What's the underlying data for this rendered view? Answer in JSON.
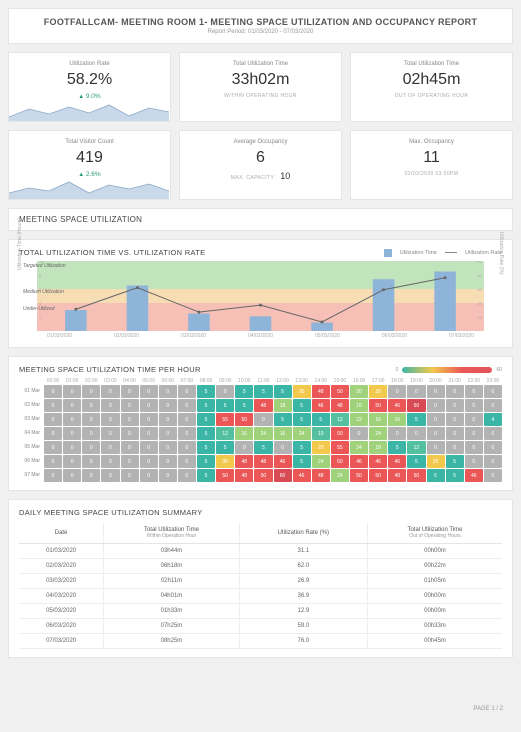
{
  "header": {
    "title": "FOOTFALLCAM- MEETING ROOM 1- MEETING SPACE UTILIZATION AND OCCUPANCY REPORT",
    "subtitle": "Report Period: 01/03/2020 - 07/03/2020"
  },
  "kpi": {
    "util_rate": {
      "label": "Utilization Rate",
      "value": "58.2%",
      "delta": "9.0%"
    },
    "util_time_in": {
      "label": "Total Utilization Time",
      "value": "33h02m",
      "caption": "WITHIN OPERATING HOUR"
    },
    "util_time_out": {
      "label": "Total Utilization Time",
      "value": "02h45m",
      "caption": "OUT OF OPERATING HOUR"
    },
    "visitor": {
      "label": "Total Visitor Count",
      "value": "419",
      "delta": "2.6%"
    },
    "avg_occ": {
      "label": "Average Occupancy",
      "value": "6",
      "maxcap_label": "MAX. CAPACITY",
      "maxcap_value": "10"
    },
    "max_occ": {
      "label": "Max. Occupancy",
      "value": "11",
      "caption": "02/03/2020 03:00PM"
    }
  },
  "sections": {
    "meeting_space": "MEETING SPACE UTILIZATION",
    "chart1_title": "TOTAL UTILIZATION TIME VS. UTILIZATION RATE",
    "legend_bar": "Utilization Time",
    "legend_line": "Utilization Rate",
    "y_left": "Utilization Time (Hours)",
    "y_right": "Utilization Rate (%)",
    "band_target": "Targeted Utilization",
    "band_medium": "Medium Utilization",
    "band_under": "Under-Utilized",
    "heatmap_title": "MEETING SPACE UTILIZATION TIME PER HOUR",
    "summary_title": "DAILY MEETING SPACE UTILIZATION SUMMARY",
    "colorbar_min": "0",
    "colorbar_max": "60"
  },
  "chart_data": [
    {
      "type": "bar+line",
      "title": "TOTAL UTILIZATION TIME VS. UTILIZATION RATE",
      "categories": [
        "01/03/2020",
        "02/03/2020",
        "03/03/2020",
        "04/03/2020",
        "05/03/2020",
        "06/03/2020",
        "07/03/2020"
      ],
      "series": [
        {
          "name": "Utilization Time",
          "type": "bar",
          "axis": "left",
          "values": [
            3.0,
            6.5,
            2.5,
            2.1,
            1.2,
            7.4,
            8.5
          ]
        },
        {
          "name": "Utilization Rate",
          "type": "line",
          "axis": "right",
          "values": [
            31.1,
            62.0,
            26.9,
            36.9,
            12.9,
            59.0,
            76.0
          ]
        }
      ],
      "yleft": {
        "label": "Utilization Time (Hours)",
        "lim": [
          0,
          10
        ],
        "ticks": [
          2,
          4,
          6,
          8,
          10
        ]
      },
      "yright": {
        "label": "Utilization Rate (%)",
        "lim": [
          0,
          100
        ],
        "ticks": [
          20,
          40,
          60,
          80,
          100
        ]
      },
      "bands": [
        {
          "label": "Under-Utilized",
          "range": [
            0,
            40
          ],
          "color": "#f2a598"
        },
        {
          "label": "Medium Utilization",
          "range": [
            40,
            60
          ],
          "color": "#f3cf94"
        },
        {
          "label": "Targeted Utilization",
          "range": [
            60,
            100
          ],
          "color": "#a8d9a0"
        }
      ]
    },
    {
      "type": "heatmap",
      "title": "MEETING SPACE UTILIZATION TIME PER HOUR",
      "x": [
        "00:00",
        "01:00",
        "02:00",
        "03:00",
        "04:00",
        "05:00",
        "06:00",
        "07:00",
        "08:00",
        "09:00",
        "10:00",
        "11:00",
        "12:00",
        "13:00",
        "14:00",
        "15:00",
        "16:00",
        "17:00",
        "18:00",
        "19:00",
        "20:00",
        "21:00",
        "22:00",
        "23:00"
      ],
      "y": [
        "01 Mar",
        "02 Mar",
        "03 Mar",
        "04 Mar",
        "05 Mar",
        "06 Mar",
        "07 Mar"
      ],
      "colorlim": [
        0,
        60
      ],
      "z": [
        [
          0,
          0,
          0,
          0,
          0,
          0,
          0,
          0,
          5,
          0,
          5,
          5,
          5,
          30,
          48,
          50,
          20,
          30,
          0,
          0,
          0,
          0,
          0,
          0
        ],
        [
          0,
          0,
          0,
          0,
          0,
          0,
          0,
          0,
          5,
          5,
          5,
          48,
          18,
          5,
          46,
          48,
          16,
          50,
          46,
          60,
          0,
          0,
          0,
          0
        ],
        [
          0,
          0,
          0,
          0,
          0,
          0,
          0,
          0,
          5,
          55,
          50,
          0,
          5,
          5,
          5,
          12,
          22,
          16,
          16,
          5,
          0,
          0,
          0,
          4
        ],
        [
          0,
          0,
          0,
          0,
          0,
          0,
          0,
          0,
          5,
          12,
          16,
          24,
          16,
          24,
          10,
          50,
          0,
          24,
          0,
          0,
          0,
          0,
          0,
          0
        ],
        [
          0,
          0,
          0,
          0,
          0,
          0,
          0,
          0,
          5,
          5,
          0,
          5,
          0,
          5,
          29,
          55,
          24,
          18,
          5,
          12,
          0,
          0,
          0,
          0
        ],
        [
          0,
          0,
          0,
          0,
          0,
          0,
          0,
          0,
          5,
          30,
          48,
          48,
          46,
          5,
          24,
          50,
          46,
          46,
          46,
          5,
          33,
          5,
          0,
          0
        ],
        [
          0,
          0,
          0,
          0,
          0,
          0,
          0,
          0,
          5,
          50,
          48,
          50,
          60,
          46,
          48,
          24,
          50,
          50,
          48,
          50,
          5,
          5,
          46,
          0
        ]
      ]
    },
    {
      "type": "table",
      "title": "DAILY MEETING SPACE UTILIZATION SUMMARY",
      "columns": [
        "Date",
        "Total Utilization Time Within Operation Hour",
        "Utilization Rate (%)",
        "Total Utilization Time Out of Operating Hours"
      ],
      "rows": [
        [
          "01/03/2020",
          "03h44m",
          "31.1",
          "00h00m"
        ],
        [
          "02/03/2020",
          "06h18m",
          "62.0",
          "00h22m"
        ],
        [
          "03/03/2020",
          "02h11m",
          "26.9",
          "01h05m"
        ],
        [
          "04/03/2020",
          "04h01m",
          "36.9",
          "00h00m"
        ],
        [
          "05/03/2020",
          "01h33m",
          "12.9",
          "00h00m"
        ],
        [
          "06/03/2020",
          "07h25m",
          "59.0",
          "00h33m"
        ],
        [
          "07/03/2020",
          "08h25m",
          "76.0",
          "00h45m"
        ]
      ]
    }
  ],
  "footer": {
    "page": "PAGE 1 / 2"
  }
}
